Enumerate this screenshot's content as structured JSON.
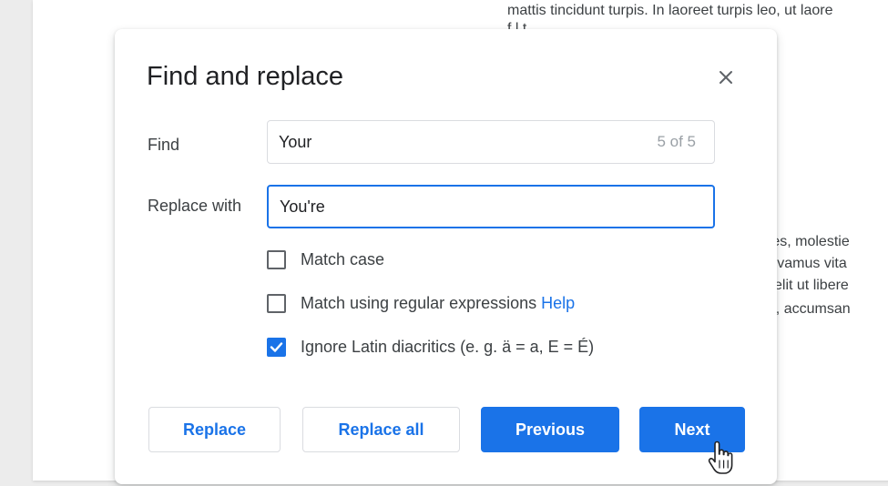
{
  "document": {
    "top_line_1": "mattis tincidunt turpis. In laoreet turpis leo, ut laore",
    "top_line_2": "f     l t    ",
    "right_line_1": "dales, molestie",
    "right_line_2": "t. Vivamus vita",
    "right_line_3": "is velit ut libere",
    "right_line_4": "sed, accumsan"
  },
  "dialog": {
    "title": "Find and replace",
    "close_icon": "close-icon",
    "find": {
      "label": "Find",
      "value": "Your",
      "match_count": "5 of 5"
    },
    "replace": {
      "label": "Replace with",
      "value": "You're"
    },
    "options": {
      "match_case": {
        "label": "Match case",
        "checked": false
      },
      "regex": {
        "label": "Match using regular expressions",
        "help_label": "Help",
        "checked": false
      },
      "ignore_latin": {
        "label": "Ignore Latin diacritics (e. g. ä = a, E = É)",
        "checked": true
      }
    },
    "buttons": {
      "replace": "Replace",
      "replace_all": "Replace all",
      "previous": "Previous",
      "next": "Next"
    }
  },
  "colors": {
    "accent": "#1a73e8",
    "text": "#3c4043",
    "border": "#dadce0",
    "muted": "#9aa0a6"
  },
  "cursor_icon": "hand-pointer-icon"
}
